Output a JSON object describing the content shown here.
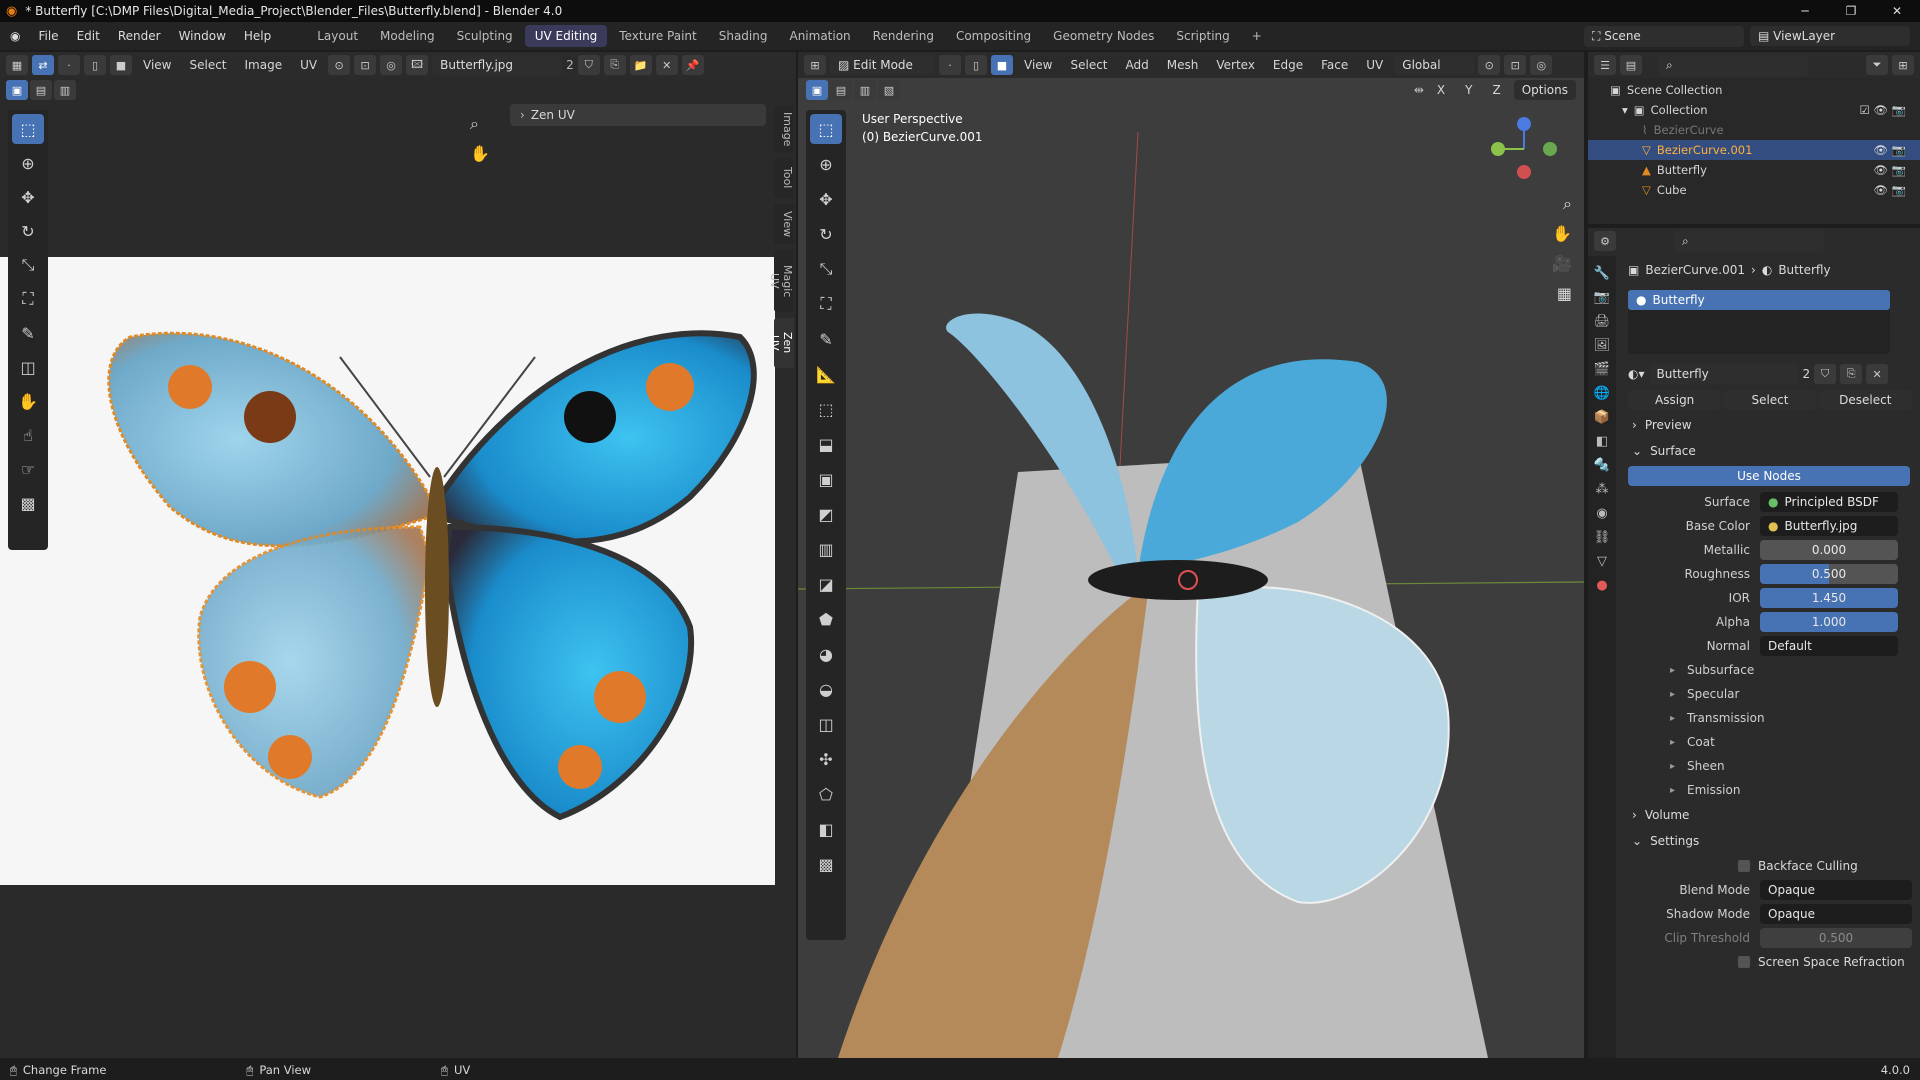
{
  "title": "* Butterfly [C:\\DMP Files\\Digital_Media_Project\\Blender_Files\\Butterfly.blend] - Blender 4.0",
  "menus": [
    "File",
    "Edit",
    "Render",
    "Window",
    "Help"
  ],
  "workspaces": [
    "Layout",
    "Modeling",
    "Sculpting",
    "UV Editing",
    "Texture Paint",
    "Shading",
    "Animation",
    "Rendering",
    "Compositing",
    "Geometry Nodes",
    "Scripting"
  ],
  "active_workspace": "UV Editing",
  "scene": "Scene",
  "view_layer": "ViewLayer",
  "uv": {
    "menus": [
      "View",
      "Select",
      "Image",
      "UV"
    ],
    "image": "Butterfly.jpg",
    "users": "2",
    "panel": "Zen UV",
    "tabs": [
      "Image",
      "Tool",
      "View",
      "Magic UV",
      "Zen UV"
    ]
  },
  "viewport": {
    "mode": "Edit Mode",
    "menus": [
      "View",
      "Select",
      "Add",
      "Mesh",
      "Vertex",
      "Edge",
      "Face",
      "UV"
    ],
    "orientation": "Global",
    "options": "Options",
    "axes": [
      "X",
      "Y",
      "Z"
    ],
    "persp": "User Perspective",
    "obj": "(0) BezierCurve.001"
  },
  "outliner": {
    "scene_collection": "Scene Collection",
    "collection": "Collection",
    "items": [
      "BezierCurve",
      "BezierCurve.001",
      "Butterfly",
      "Cube"
    ]
  },
  "props": {
    "breadcrumb_obj": "BezierCurve.001",
    "breadcrumb_mat": "Butterfly",
    "slot": "Butterfly",
    "material": "Butterfly",
    "users": "2",
    "assign": "Assign",
    "select": "Select",
    "deselect": "Deselect",
    "preview": "Preview",
    "surface_hdr": "Surface",
    "use_nodes": "Use Nodes",
    "surface": "Surface",
    "surface_val": "Principled BSDF",
    "base_color": "Base Color",
    "base_color_val": "Butterfly.jpg",
    "metallic": "Metallic",
    "metallic_val": "0.000",
    "roughness": "Roughness",
    "roughness_val": "0.500",
    "ior": "IOR",
    "ior_val": "1.450",
    "alpha": "Alpha",
    "alpha_val": "1.000",
    "normal": "Normal",
    "normal_val": "Default",
    "subs": [
      "Subsurface",
      "Specular",
      "Transmission",
      "Coat",
      "Sheen",
      "Emission"
    ],
    "volume": "Volume",
    "settings": "Settings",
    "backface": "Backface Culling",
    "blend_mode": "Blend Mode",
    "blend_val": "Opaque",
    "shadow_mode": "Shadow Mode",
    "shadow_val": "Opaque",
    "clip": "Clip Threshold",
    "clip_val": "0.500",
    "ssr": "Screen Space Refraction"
  },
  "status": {
    "a": "Change Frame",
    "b": "Pan View",
    "c": "UV",
    "version": "4.0.0"
  },
  "colors": {
    "accent": "#4772b3",
    "select": "#e08a24"
  }
}
